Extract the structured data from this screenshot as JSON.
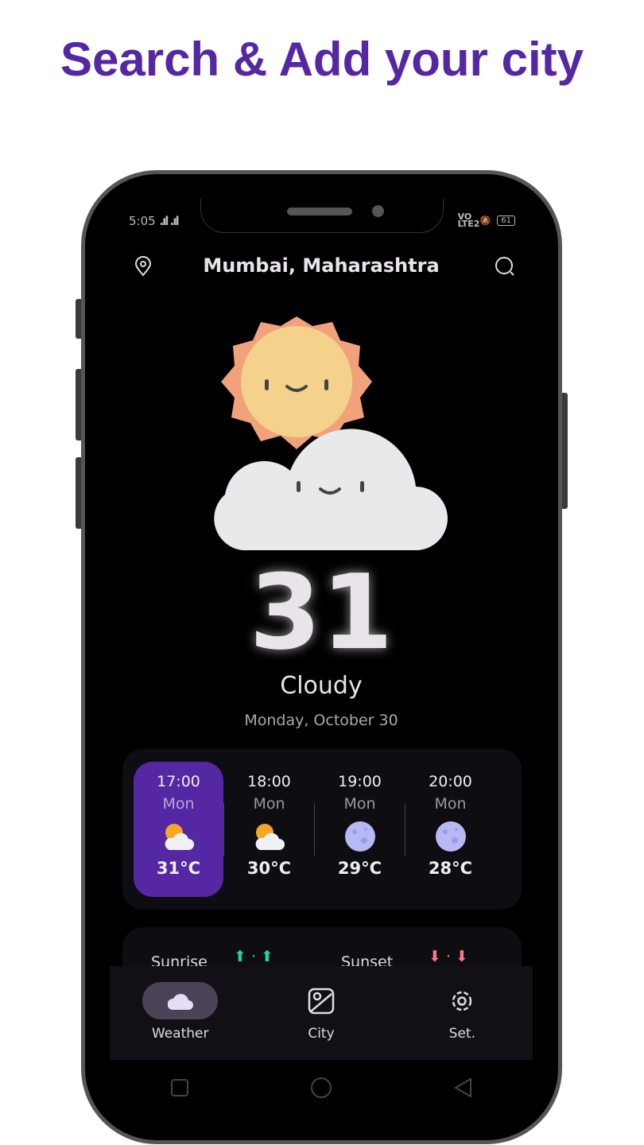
{
  "headline": "Search & Add your city",
  "status": {
    "time": "5:05",
    "network": "VO LTE2",
    "battery": "61"
  },
  "header": {
    "city": "Mumbai, Maharashtra",
    "left_icon": "location-pin-icon",
    "right_icon": "search-icon"
  },
  "current": {
    "temperature": "31",
    "condition": "Cloudy",
    "date": "Monday, October 30",
    "icon": "sun-behind-cloud"
  },
  "hourly": [
    {
      "time": "17:00",
      "day": "Mon",
      "temp": "31°C",
      "icon": "partly-cloudy",
      "selected": true
    },
    {
      "time": "18:00",
      "day": "Mon",
      "temp": "30°C",
      "icon": "partly-cloudy"
    },
    {
      "time": "19:00",
      "day": "Mon",
      "temp": "29°C",
      "icon": "moon"
    },
    {
      "time": "20:00",
      "day": "Mon",
      "temp": "28°C",
      "icon": "moon"
    }
  ],
  "sun": {
    "sunrise_label": "Sunrise",
    "sunset_label": "Sunset"
  },
  "nav": [
    {
      "label": "Weather",
      "icon": "cloud-icon",
      "active": true
    },
    {
      "label": "City",
      "icon": "map-icon"
    },
    {
      "label": "Set.",
      "icon": "gear-icon"
    }
  ],
  "colors": {
    "accent": "#5527a3",
    "card": "#0e0d12"
  }
}
